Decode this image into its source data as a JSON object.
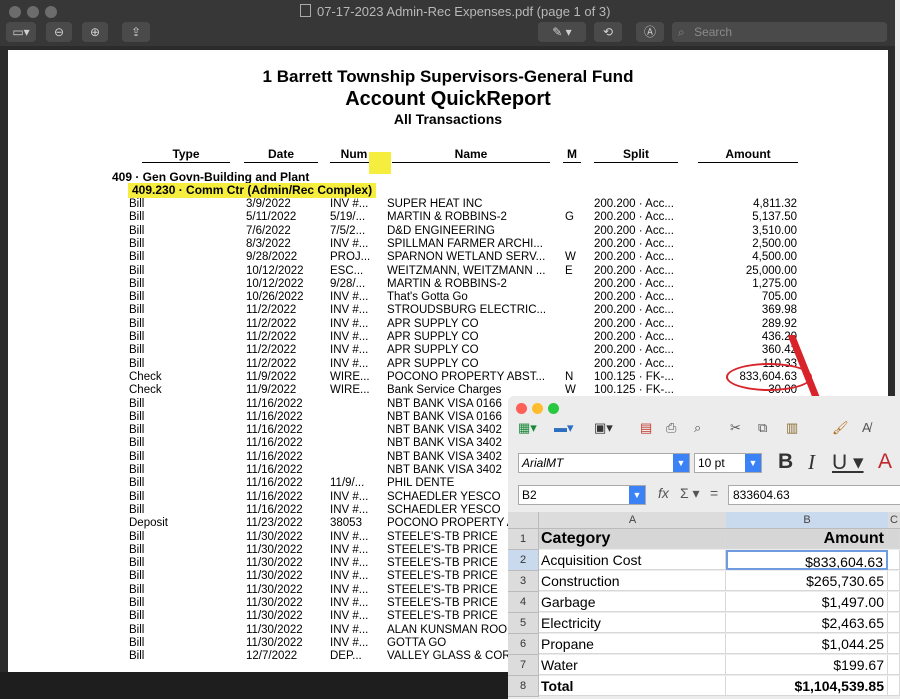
{
  "viewer": {
    "title": "07-17-2023 Admin-Rec Expenses.pdf (page 1 of 3)",
    "search_placeholder": "Search"
  },
  "report": {
    "title_line1": "1 Barrett Township Supervisors-General Fund",
    "title_line2": "Account QuickReport",
    "title_line3": "All Transactions",
    "columns": [
      "Type",
      "Date",
      "Num",
      "Name",
      "M",
      "Split",
      "Amount"
    ],
    "account": "409 · Gen Govn-Building and Plant",
    "subaccount": "409.230 · Comm Ctr (Admin/Rec Complex)",
    "rows": [
      {
        "type": "Bill",
        "date": "3/9/2022",
        "num": "INV #...",
        "name": "SUPER HEAT INC",
        "m": "",
        "split": "200.200 · Acc...",
        "amount": "4,811.32"
      },
      {
        "type": "Bill",
        "date": "5/11/2022",
        "num": "5/19/...",
        "name": "MARTIN & ROBBINS-2",
        "m": "G",
        "split": "200.200 · Acc...",
        "amount": "5,137.50"
      },
      {
        "type": "Bill",
        "date": "7/6/2022",
        "num": "7/5/2...",
        "name": "D&D ENGINEERING",
        "m": "",
        "split": "200.200 · Acc...",
        "amount": "3,510.00"
      },
      {
        "type": "Bill",
        "date": "8/3/2022",
        "num": "INV #...",
        "name": "SPILLMAN FARMER ARCHI...",
        "m": "",
        "split": "200.200 · Acc...",
        "amount": "2,500.00"
      },
      {
        "type": "Bill",
        "date": "9/28/2022",
        "num": "PROJ...",
        "name": "SPARNON WETLAND SERV...",
        "m": "W",
        "split": "200.200 · Acc...",
        "amount": "4,500.00"
      },
      {
        "type": "Bill",
        "date": "10/12/2022",
        "num": "ESC...",
        "name": "WEITZMANN, WEITZMANN ...",
        "m": "E",
        "split": "200.200 · Acc...",
        "amount": "25,000.00"
      },
      {
        "type": "Bill",
        "date": "10/12/2022",
        "num": "9/28/...",
        "name": "MARTIN & ROBBINS-2",
        "m": "",
        "split": "200.200 · Acc...",
        "amount": "1,275.00"
      },
      {
        "type": "Bill",
        "date": "10/26/2022",
        "num": "INV #...",
        "name": "That's Gotta Go",
        "m": "",
        "split": "200.200 · Acc...",
        "amount": "705.00"
      },
      {
        "type": "Bill",
        "date": "11/2/2022",
        "num": "INV #...",
        "name": "STROUDSBURG ELECTRIC...",
        "m": "",
        "split": "200.200 · Acc...",
        "amount": "369.98"
      },
      {
        "type": "Bill",
        "date": "11/2/2022",
        "num": "INV #...",
        "name": "APR SUPPLY CO",
        "m": "",
        "split": "200.200 · Acc...",
        "amount": "289.92"
      },
      {
        "type": "Bill",
        "date": "11/2/2022",
        "num": "INV #...",
        "name": "APR SUPPLY CO",
        "m": "",
        "split": "200.200 · Acc...",
        "amount": "436.20"
      },
      {
        "type": "Bill",
        "date": "11/2/2022",
        "num": "INV #...",
        "name": "APR SUPPLY CO",
        "m": "",
        "split": "200.200 · Acc...",
        "amount": "360.42"
      },
      {
        "type": "Bill",
        "date": "11/2/2022",
        "num": "INV #...",
        "name": "APR SUPPLY CO",
        "m": "",
        "split": "200.200 · Acc...",
        "amount": "110.33"
      },
      {
        "type": "Check",
        "date": "11/9/2022",
        "num": "WIRE...",
        "name": "POCONO PROPERTY ABST...",
        "m": "N",
        "split": "100.125 · FK-...",
        "amount": "833,604.63"
      },
      {
        "type": "Check",
        "date": "11/9/2022",
        "num": "WIRE...",
        "name": "Bank Service Charges",
        "m": "W",
        "split": "100.125 · FK-...",
        "amount": "30.00"
      },
      {
        "type": "Bill",
        "date": "11/16/2022",
        "num": "",
        "name": "NBT BANK VISA 0166",
        "m": "",
        "split": "",
        "amount": ""
      },
      {
        "type": "Bill",
        "date": "11/16/2022",
        "num": "",
        "name": "NBT BANK VISA 0166",
        "m": "",
        "split": "",
        "amount": ""
      },
      {
        "type": "Bill",
        "date": "11/16/2022",
        "num": "",
        "name": "NBT BANK VISA 3402",
        "m": "",
        "split": "",
        "amount": ""
      },
      {
        "type": "Bill",
        "date": "11/16/2022",
        "num": "",
        "name": "NBT BANK VISA 3402",
        "m": "",
        "split": "",
        "amount": ""
      },
      {
        "type": "Bill",
        "date": "11/16/2022",
        "num": "",
        "name": "NBT BANK VISA 3402",
        "m": "",
        "split": "",
        "amount": ""
      },
      {
        "type": "Bill",
        "date": "11/16/2022",
        "num": "",
        "name": "NBT BANK VISA 3402",
        "m": "",
        "split": "",
        "amount": ""
      },
      {
        "type": "Bill",
        "date": "11/16/2022",
        "num": "11/9/...",
        "name": "PHIL DENTE",
        "m": "",
        "split": "",
        "amount": ""
      },
      {
        "type": "Bill",
        "date": "11/16/2022",
        "num": "INV #...",
        "name": "SCHAEDLER YESCO",
        "m": "",
        "split": "",
        "amount": ""
      },
      {
        "type": "Bill",
        "date": "11/16/2022",
        "num": "INV #...",
        "name": "SCHAEDLER YESCO",
        "m": "",
        "split": "",
        "amount": ""
      },
      {
        "type": "Deposit",
        "date": "11/23/2022",
        "num": "38053",
        "name": "POCONO PROPERTY A",
        "m": "",
        "split": "",
        "amount": ""
      },
      {
        "type": "Bill",
        "date": "11/30/2022",
        "num": "INV #...",
        "name": "STEELE'S-TB PRICE",
        "m": "",
        "split": "",
        "amount": ""
      },
      {
        "type": "Bill",
        "date": "11/30/2022",
        "num": "INV #...",
        "name": "STEELE'S-TB PRICE",
        "m": "",
        "split": "",
        "amount": ""
      },
      {
        "type": "Bill",
        "date": "11/30/2022",
        "num": "INV #...",
        "name": "STEELE'S-TB PRICE",
        "m": "",
        "split": "",
        "amount": ""
      },
      {
        "type": "Bill",
        "date": "11/30/2022",
        "num": "INV #...",
        "name": "STEELE'S-TB PRICE",
        "m": "",
        "split": "",
        "amount": ""
      },
      {
        "type": "Bill",
        "date": "11/30/2022",
        "num": "INV #...",
        "name": "STEELE'S-TB PRICE",
        "m": "",
        "split": "",
        "amount": ""
      },
      {
        "type": "Bill",
        "date": "11/30/2022",
        "num": "INV #...",
        "name": "STEELE'S-TB PRICE",
        "m": "",
        "split": "",
        "amount": ""
      },
      {
        "type": "Bill",
        "date": "11/30/2022",
        "num": "INV #...",
        "name": "STEELE'S-TB PRICE",
        "m": "",
        "split": "",
        "amount": ""
      },
      {
        "type": "Bill",
        "date": "11/30/2022",
        "num": "INV #...",
        "name": "ALAN KUNSMAN ROOF",
        "m": "",
        "split": "",
        "amount": ""
      },
      {
        "type": "Bill",
        "date": "11/30/2022",
        "num": "INV #...",
        "name": "GOTTA GO",
        "m": "",
        "split": "",
        "amount": ""
      },
      {
        "type": "Bill",
        "date": "12/7/2022",
        "num": "DEP...",
        "name": "VALLEY GLASS & COR",
        "m": "",
        "split": "",
        "amount": ""
      }
    ]
  },
  "spreadsheet": {
    "font_name": "ArialMT",
    "font_size": "10 pt",
    "name_box": "B2",
    "formula_value": "833604.63",
    "col_headers": [
      "A",
      "B",
      "C"
    ],
    "header_row": {
      "num": "1",
      "a": "Category",
      "b": "Amount"
    },
    "rows": [
      {
        "num": "2",
        "a": "Acquisition Cost",
        "b": "$833,604.63"
      },
      {
        "num": "3",
        "a": "Construction",
        "b": "$265,730.65"
      },
      {
        "num": "4",
        "a": "Garbage",
        "b": "$1,497.00"
      },
      {
        "num": "5",
        "a": "Electricity",
        "b": "$2,463.65"
      },
      {
        "num": "6",
        "a": "Propane",
        "b": "$1,044.25"
      },
      {
        "num": "7",
        "a": "Water",
        "b": "$199.67"
      }
    ],
    "total_row": {
      "num": "8",
      "a": "Total",
      "b": "$1,104,539.85"
    },
    "colors": {
      "selection": "#6f9be0",
      "annotation": "#d8232a",
      "highlight": "#f5ee3f"
    }
  }
}
